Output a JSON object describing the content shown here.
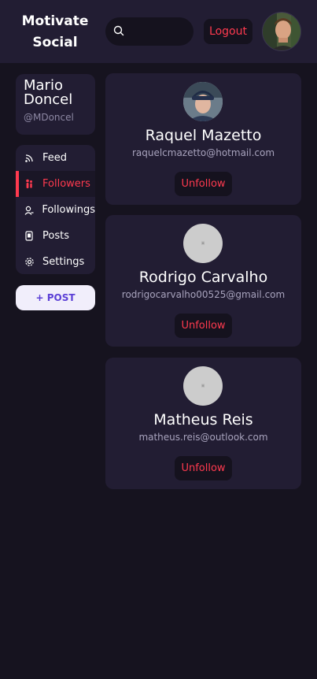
{
  "header": {
    "brand_line1": "Motivate",
    "brand_line2": "Social",
    "search_placeholder": "",
    "logout_label": "Logout"
  },
  "profile": {
    "first_name": "Mario",
    "last_name": "Doncel",
    "handle": "@MDoncel"
  },
  "nav": {
    "items": [
      {
        "label": "Feed",
        "icon": "rss-icon"
      },
      {
        "label": "Followers",
        "icon": "followers-icon"
      },
      {
        "label": "Followings",
        "icon": "user-icon"
      },
      {
        "label": "Posts",
        "icon": "posts-icon"
      },
      {
        "label": "Settings",
        "icon": "gear-icon"
      }
    ],
    "active": "Followers"
  },
  "post_button": "+ POST",
  "followers": [
    {
      "name": "Raquel Mazetto",
      "email": "raquelcmazetto@hotmail.com",
      "action": "Unfollow",
      "avatar": "photo"
    },
    {
      "name": "Rodrigo Carvalho",
      "email": "rodrigocarvalho00525@gmail.com",
      "action": "Unfollow",
      "avatar": "placeholder"
    },
    {
      "name": "Matheus Reis",
      "email": "matheus.reis@outlook.com",
      "action": "Unfollow",
      "avatar": "placeholder"
    }
  ],
  "colors": {
    "background": "#16131f",
    "panel": "#221d33",
    "accent": "#ff3a4f",
    "post_text": "#5b3fd6"
  }
}
